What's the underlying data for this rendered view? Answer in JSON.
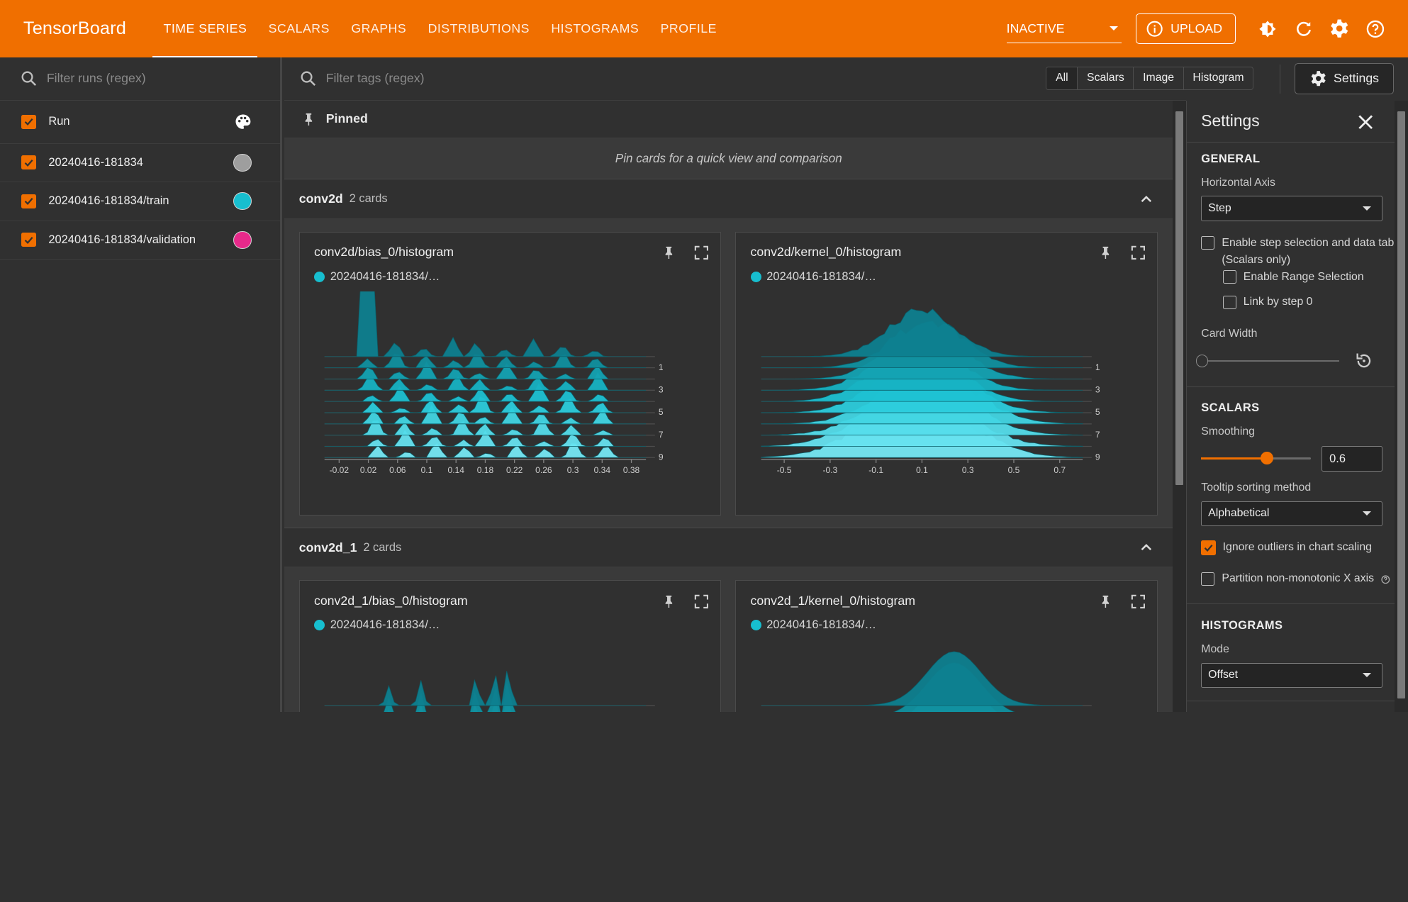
{
  "brand": "TensorBoard",
  "nav": {
    "tabs": [
      "TIME SERIES",
      "SCALARS",
      "GRAPHS",
      "DISTRIBUTIONS",
      "HISTOGRAMS",
      "PROFILE"
    ],
    "active_tab": "TIME SERIES"
  },
  "topbar": {
    "plugin_select": "INACTIVE",
    "upload_label": "UPLOAD",
    "icons": [
      "theme-icon",
      "refresh-icon",
      "settings-gear-icon",
      "help-icon"
    ]
  },
  "sidebar": {
    "filter_placeholder": "Filter runs (regex)",
    "header_label": "Run",
    "runs": [
      {
        "name": "20240416-181834",
        "color": "#9e9e9e",
        "checked": true
      },
      {
        "name": "20240416-181834/train",
        "color": "#17becf",
        "checked": true
      },
      {
        "name": "20240416-181834/validation",
        "color": "#e7298a",
        "checked": true
      }
    ]
  },
  "main": {
    "filter_placeholder": "Filter tags (regex)",
    "type_filters": [
      "All",
      "Scalars",
      "Image",
      "Histogram"
    ],
    "active_type_filter": "All",
    "settings_button": "Settings",
    "pinned": {
      "title": "Pinned",
      "empty_message": "Pin cards for a quick view and comparison"
    },
    "groups": [
      {
        "name": "conv2d",
        "count": "2 cards",
        "cards": [
          {
            "title": "conv2d/bias_0/histogram",
            "run": "20240416-181834/…"
          },
          {
            "title": "conv2d/kernel_0/histogram",
            "run": "20240416-181834/…"
          }
        ]
      },
      {
        "name": "conv2d_1",
        "count": "2 cards",
        "cards": [
          {
            "title": "conv2d_1/bias_0/histogram",
            "run": "20240416-181834/…"
          },
          {
            "title": "conv2d_1/kernel_0/histogram",
            "run": "20240416-181834/…"
          }
        ]
      }
    ]
  },
  "settings_panel": {
    "title": "Settings",
    "general": {
      "heading": "GENERAL",
      "horizontal_axis_label": "Horizontal Axis",
      "horizontal_axis_value": "Step",
      "step_selection_label": "Enable step selection and data table",
      "step_selection_sub": "(Scalars only)",
      "range_selection_label": "Enable Range Selection",
      "link_by_step_label": "Link by step 0",
      "card_width_label": "Card Width"
    },
    "scalars": {
      "heading": "SCALARS",
      "smoothing_label": "Smoothing",
      "smoothing_value": "0.6",
      "tooltip_sort_label": "Tooltip sorting method",
      "tooltip_sort_value": "Alphabetical",
      "ignore_outliers_label": "Ignore outliers in chart scaling",
      "ignore_outliers_checked": true,
      "partition_label": "Partition non-monotonic X axis",
      "partition_checked": false
    },
    "histograms": {
      "heading": "HISTOGRAMS",
      "mode_label": "Mode",
      "mode_value": "Offset"
    }
  },
  "chart_data": [
    {
      "type": "area",
      "title": "conv2d/bias_0/histogram",
      "x_ticks": [
        "-0.02",
        "0.02",
        "0.06",
        "0.1",
        "0.14",
        "0.18",
        "0.22",
        "0.26",
        "0.3",
        "0.34",
        "0.38"
      ],
      "y_ticks": [
        "1",
        "3",
        "5",
        "7",
        "9"
      ],
      "xlim": [
        -0.04,
        0.4
      ]
    },
    {
      "type": "area",
      "title": "conv2d/kernel_0/histogram",
      "x_ticks": [
        "-0.5",
        "-0.3",
        "-0.1",
        "0.1",
        "0.3",
        "0.5",
        "0.7"
      ],
      "y_ticks": [
        "1",
        "3",
        "5",
        "7",
        "9"
      ],
      "xlim": [
        -0.6,
        0.8
      ]
    }
  ],
  "colors": {
    "accent": "#f06f00",
    "histogram_fill": "#17becf"
  }
}
